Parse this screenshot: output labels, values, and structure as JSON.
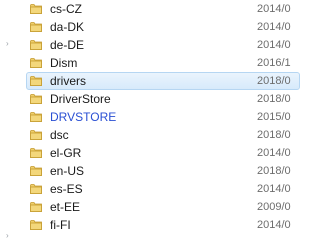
{
  "file_list": {
    "rows": [
      {
        "name": "cs-CZ",
        "date": "2014/0",
        "color": "#1a1a1a",
        "selected": false
      },
      {
        "name": "da-DK",
        "date": "2014/0",
        "color": "#1a1a1a",
        "selected": false
      },
      {
        "name": "de-DE",
        "date": "2014/0",
        "color": "#1a1a1a",
        "selected": false
      },
      {
        "name": "Dism",
        "date": "2016/1",
        "color": "#1a1a1a",
        "selected": false
      },
      {
        "name": "drivers",
        "date": "2018/0",
        "color": "#1a1a1a",
        "selected": true
      },
      {
        "name": "DriverStore",
        "date": "2018/0",
        "color": "#1a1a1a",
        "selected": false
      },
      {
        "name": "DRVSTORE",
        "date": "2015/0",
        "color": "#2a4fd3",
        "selected": false
      },
      {
        "name": "dsc",
        "date": "2018/0",
        "color": "#1a1a1a",
        "selected": false
      },
      {
        "name": "el-GR",
        "date": "2014/0",
        "color": "#1a1a1a",
        "selected": false
      },
      {
        "name": "en-US",
        "date": "2018/0",
        "color": "#1a1a1a",
        "selected": false
      },
      {
        "name": "es-ES",
        "date": "2014/0",
        "color": "#1a1a1a",
        "selected": false
      },
      {
        "name": "et-EE",
        "date": "2009/0",
        "color": "#1a1a1a",
        "selected": false
      },
      {
        "name": "fi-FI",
        "date": "2014/0",
        "color": "#1a1a1a",
        "selected": false
      }
    ]
  },
  "icons": {
    "folder": "folder-icon",
    "collapse_marker": "expand-arrow-icon"
  },
  "colors": {
    "folder_yellow": "#e8c15a",
    "selection": "#d7eafb",
    "compressed_blue": "#2a4fd3"
  }
}
